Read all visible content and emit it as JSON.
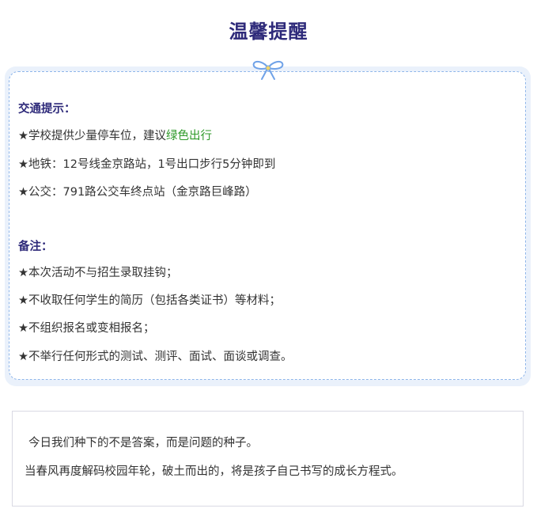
{
  "title": "温馨提醒",
  "traffic": {
    "heading": "交通提示：",
    "items": [
      {
        "text": "★学校提供少量停车位，建议",
        "highlight": "绿色出行"
      },
      {
        "text": "★地铁：12号线金京路站，1号出口步行5分钟即到"
      },
      {
        "text": "★公交：791路公交车终点站（金京路巨峰路）"
      }
    ]
  },
  "notes": {
    "heading": "备注：",
    "items": [
      "★本次活动不与招生录取挂钩；",
      "★不收取任何学生的简历（包括各类证书）等材料；",
      "★不组织报名或变相报名；",
      "★不举行任何形式的测试、测评、面试、面谈或调查。"
    ]
  },
  "quote": {
    "lines": [
      "今日我们种下的不是答案，而是问题的种子。",
      "当春风再度解码校园年轮，破土而出的，将是孩子自己书写的成长方程式。"
    ]
  },
  "colors": {
    "title": "#2e2a7a",
    "heading": "#2e2a7a",
    "highlight_green": "#2f9a2a",
    "panel_bg": "#eaf1fb",
    "dashed_border": "#8fb6ea",
    "bow": "#6fa2e8"
  },
  "icons": {
    "bow": "ribbon-bow-icon"
  }
}
